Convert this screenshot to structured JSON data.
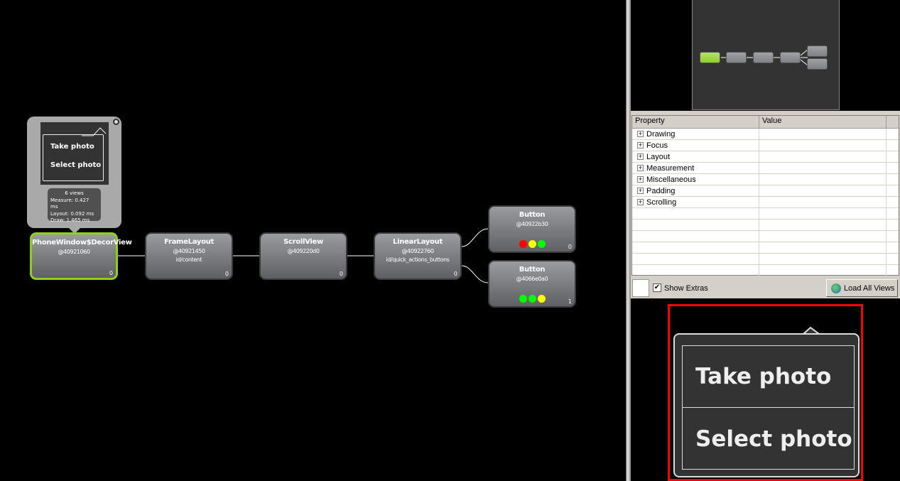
{
  "tooltip": {
    "preview_items": [
      "Take photo",
      "Select photo"
    ],
    "views": "6 views",
    "measure": "Measure:  0.427 ms",
    "layout": "Layout:  0.092 ms",
    "draw": "Draw:  1.465 ms"
  },
  "nodes": [
    {
      "name": "PhoneWindow$DecorView",
      "hash": "@40921060",
      "id": "",
      "count": "0",
      "selected": true
    },
    {
      "name": "FrameLayout",
      "hash": "@40921450",
      "id": "id/content",
      "count": "0"
    },
    {
      "name": "ScrollView",
      "hash": "@409220d0",
      "id": "",
      "count": "0"
    },
    {
      "name": "LinearLayout",
      "hash": "@40922760",
      "id": "id/quick_actions_buttons",
      "count": "0"
    },
    {
      "name": "Button",
      "hash": "@40922b30",
      "id": "",
      "count": "0",
      "indicators": [
        "#ff0000",
        "#ffff00",
        "#00ff00"
      ]
    },
    {
      "name": "Button",
      "hash": "@4066e0a0",
      "id": "",
      "count": "1",
      "indicators": [
        "#00ff00",
        "#00ff00",
        "#ffff00"
      ]
    }
  ],
  "properties": {
    "headers": [
      "Property",
      "Value"
    ],
    "groups": [
      "Drawing",
      "Focus",
      "Layout",
      "Measurement",
      "Miscellaneous",
      "Padding",
      "Scrolling"
    ]
  },
  "toolbar": {
    "show_extras": "Show Extras",
    "show_extras_checked": true,
    "load_all": "Load All Views"
  },
  "preview": {
    "items": [
      "Take photo",
      "Select photo"
    ]
  },
  "colors": {
    "selected": "#8fd016",
    "highlight": "#ff0000"
  }
}
